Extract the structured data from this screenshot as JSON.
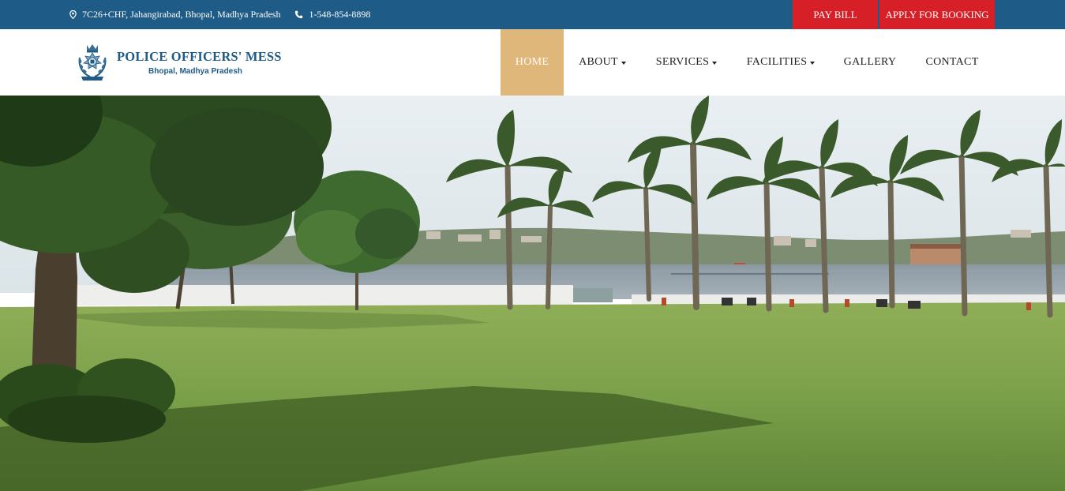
{
  "topbar": {
    "address": "7C26+CHF, Jahangirabad, Bhopal, Madhya Pradesh",
    "phone": "1-548-854-8898",
    "address_icon": "map-pin-icon",
    "phone_icon": "phone-icon",
    "pay_bill": "PAY BILL",
    "apply_booking": "APPLY FOR BOOKING"
  },
  "brand": {
    "name": "POLICE OFFICERS' MESS",
    "location": "Bhopal, Madhya Pradesh",
    "emblem_icon": "police-emblem-icon"
  },
  "nav": {
    "home": "HOME",
    "about": "ABOUT",
    "services": "SERVICES",
    "facilities": "FACILITIES",
    "gallery": "GALLERY",
    "contact": "CONTACT"
  },
  "colors": {
    "topbar": "#1e5b86",
    "button_red": "#d71f27",
    "nav_active": "#dfb77b",
    "brand_blue": "#1e5b86"
  },
  "hero": {
    "image": "lakeside-lawn-with-palm-trees"
  }
}
